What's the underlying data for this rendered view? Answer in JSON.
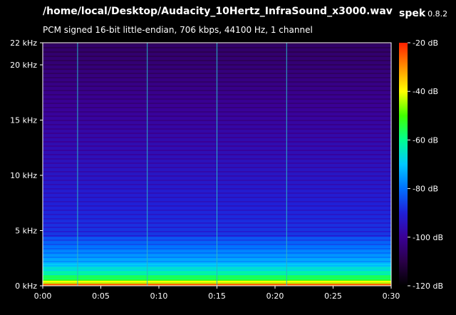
{
  "window": {
    "title": "/home/local/Desktop/Audacity_10Hertz_InfraSound_x3000.wav",
    "app_name": "spek",
    "app_version": "0.8.2",
    "subtitle": "PCM signed 16-bit little-endian, 706 kbps, 44100 Hz, 1 channel"
  },
  "colors": {
    "background": "#000000",
    "text": "#ffffff",
    "marker_line": "#2bb3c7",
    "palette": [
      "#000000",
      "#2a0048",
      "#3a0096",
      "#2020d8",
      "#0070ff",
      "#00c8ff",
      "#00ff90",
      "#40ff00",
      "#ffff00",
      "#ff9000",
      "#ff2000"
    ]
  },
  "chart_data": {
    "type": "heatmap",
    "x_axis": {
      "ticks": [
        "0:00",
        "0:05",
        "0:10",
        "0:15",
        "0:20",
        "0:25",
        "0:30"
      ],
      "range_seconds": [
        0,
        30
      ]
    },
    "y_axis": {
      "ticks": [
        "0 kHz",
        "5 kHz",
        "10 kHz",
        "15 kHz",
        "20 kHz",
        "22 kHz"
      ],
      "tick_values_khz": [
        0,
        5,
        10,
        15,
        20,
        22
      ],
      "range_khz": [
        0,
        22
      ]
    },
    "color_scale": {
      "ticks": [
        "-20 dB",
        "-40 dB",
        "-60 dB",
        "-80 dB",
        "-100 dB",
        "-120 dB"
      ],
      "tick_values_db": [
        -20,
        -40,
        -60,
        -80,
        -100,
        -120
      ],
      "range_db": [
        -120,
        -20
      ]
    },
    "vertical_markers_seconds": [
      3,
      9,
      15,
      21
    ]
  }
}
